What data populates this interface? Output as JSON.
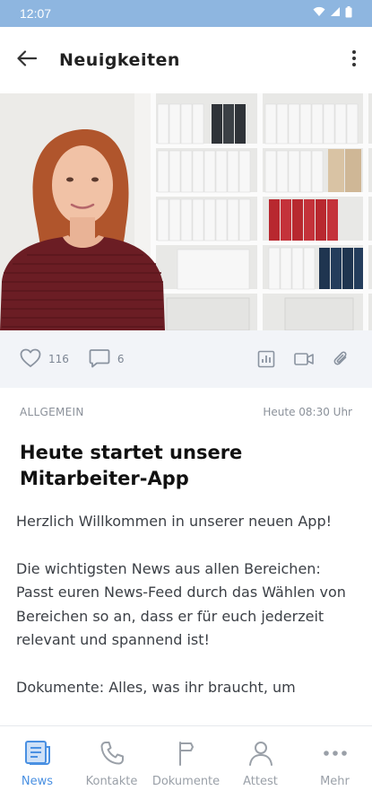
{
  "status_bar": {
    "time": "12:07",
    "icons": [
      "wifi-icon",
      "signal-icon",
      "battery-icon"
    ]
  },
  "app_bar": {
    "title": "Neuigkeiten",
    "back_icon": "arrow-left-icon",
    "menu_icon": "more-vertical-icon"
  },
  "post": {
    "image": "person-in-office-photo",
    "likes": "116",
    "comments": "6",
    "category": "ALLGEMEIN",
    "timestamp": "Heute 08:30 Uhr",
    "title": "Heute startet unsere Mitarbeiter-App",
    "paragraphs": [
      "Herzlich Willkommen in unserer neuen App!",
      "Die wichtigsten News aus allen Bereichen: Passt euren News-Feed durch das Wählen von Bereichen so an, dass er für euch jederzeit relevant und spannend ist!",
      "Dokumente: Alles, was ihr braucht, um"
    ]
  },
  "tabs": [
    {
      "label": "News",
      "icon": "newspaper-icon",
      "active": true
    },
    {
      "label": "Kontakte",
      "icon": "phone-icon",
      "active": false
    },
    {
      "label": "Dokumente",
      "icon": "flag-icon",
      "active": false
    },
    {
      "label": "Attest",
      "icon": "person-icon",
      "active": false
    },
    {
      "label": "Mehr",
      "icon": "more-horizontal-icon",
      "active": false
    }
  ],
  "colors": {
    "accent": "#4a90e2",
    "status_bar": "#8eb6e0",
    "action_row_bg": "#f2f4f8",
    "inactive": "#9aa0a8"
  }
}
